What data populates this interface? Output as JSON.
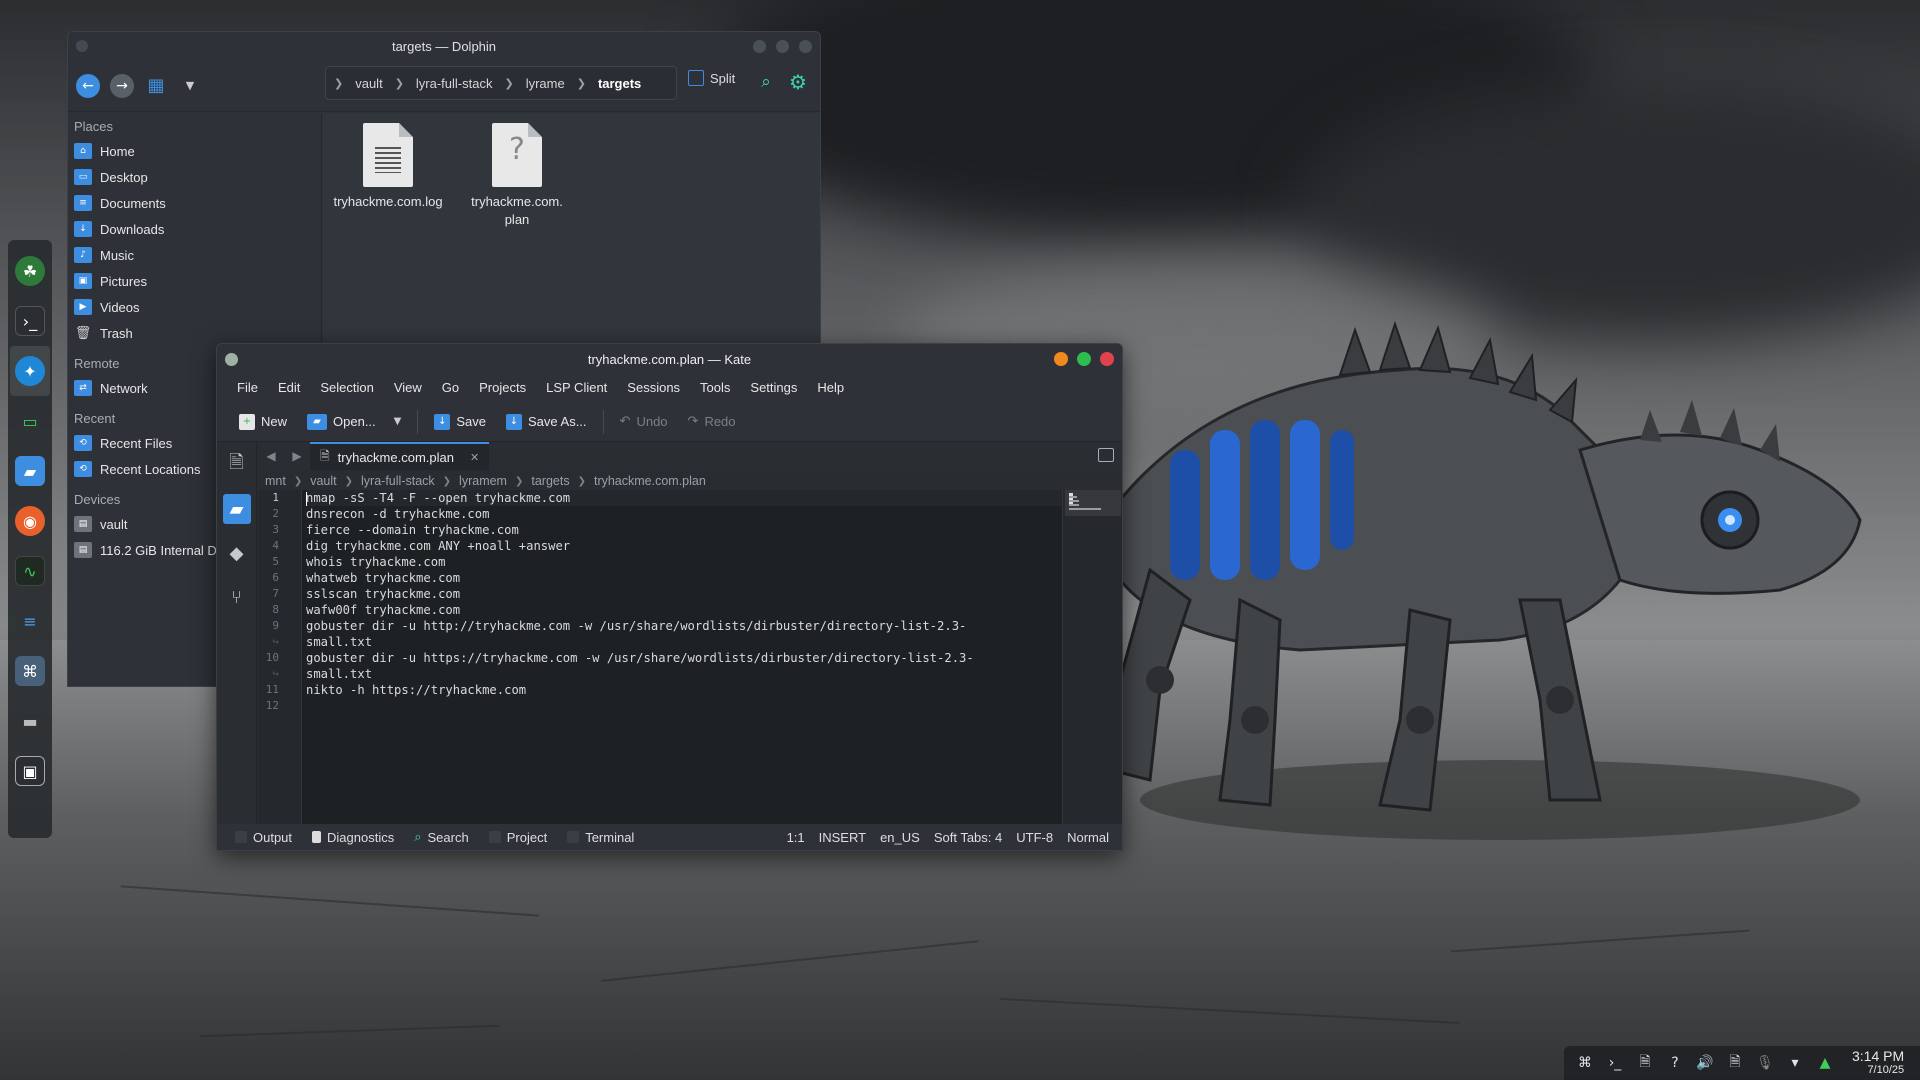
{
  "dolphin": {
    "title": "targets — Dolphin",
    "breadcrumbs": [
      "vault",
      "lyra-full-stack",
      "lyrame",
      "targets"
    ],
    "split_label": "Split",
    "places_header": "Places",
    "places": [
      "Home",
      "Desktop",
      "Documents",
      "Downloads",
      "Music",
      "Pictures",
      "Videos",
      "Trash"
    ],
    "remote_header": "Remote",
    "remote": [
      "Network"
    ],
    "recent_header": "Recent",
    "recent": [
      "Recent Files",
      "Recent Locations"
    ],
    "devices_header": "Devices",
    "devices": [
      "vault",
      "116.2 GiB Internal D"
    ],
    "files": [
      {
        "name": "tryhackme.com.log",
        "icon": "text-file-icon"
      },
      {
        "name": "tryhackme.com.\nplan",
        "icon": "unknown-file-icon"
      }
    ]
  },
  "kate": {
    "title": "tryhackme.com.plan — Kate",
    "menu": [
      "File",
      "Edit",
      "Selection",
      "View",
      "Go",
      "Projects",
      "LSP Client",
      "Sessions",
      "Tools",
      "Settings",
      "Help"
    ],
    "toolbar": {
      "new": "New",
      "open": "Open...",
      "save": "Save",
      "save_as": "Save As...",
      "undo": "Undo",
      "redo": "Redo"
    },
    "tab_label": "tryhackme.com.plan",
    "breadcrumbs": [
      "mnt",
      "vault",
      "lyra-full-stack",
      "lyramem",
      "targets",
      "tryhackme.com.plan"
    ],
    "line_numbers": [
      "1",
      "2",
      "3",
      "4",
      "5",
      "6",
      "7",
      "8",
      "9",
      "↪",
      "10",
      "↪",
      "11",
      "12"
    ],
    "lines": [
      "nmap -sS -T4 -F --open tryhackme.com",
      "dnsrecon -d tryhackme.com",
      "fierce --domain tryhackme.com",
      "dig tryhackme.com ANY +noall +answer",
      "whois tryhackme.com",
      "whatweb tryhackme.com",
      "sslscan tryhackme.com",
      "wafw00f tryhackme.com",
      "gobuster dir -u http://tryhackme.com -w /usr/share/wordlists/dirbuster/directory-list-2.3-",
      "small.txt",
      "gobuster dir -u https://tryhackme.com -w /usr/share/wordlists/dirbuster/directory-list-2.3-",
      "small.txt",
      "nikto -h https://tryhackme.com",
      ""
    ],
    "status_left": [
      "Output",
      "Diagnostics",
      "Search",
      "Project",
      "Terminal"
    ],
    "status_right": {
      "cursor": "1:1",
      "mode": "INSERT",
      "language": "en_US",
      "indent": "Soft Tabs: 4",
      "encoding": "UTF-8",
      "input_mode": "Normal"
    }
  },
  "tray": {
    "time": "3:14 PM",
    "date": "7/10/25"
  },
  "colors": {
    "accent": "#3d8ee0",
    "close": "#e0434b",
    "maximize": "#2dbc4e",
    "minimize": "#f08a1e"
  }
}
